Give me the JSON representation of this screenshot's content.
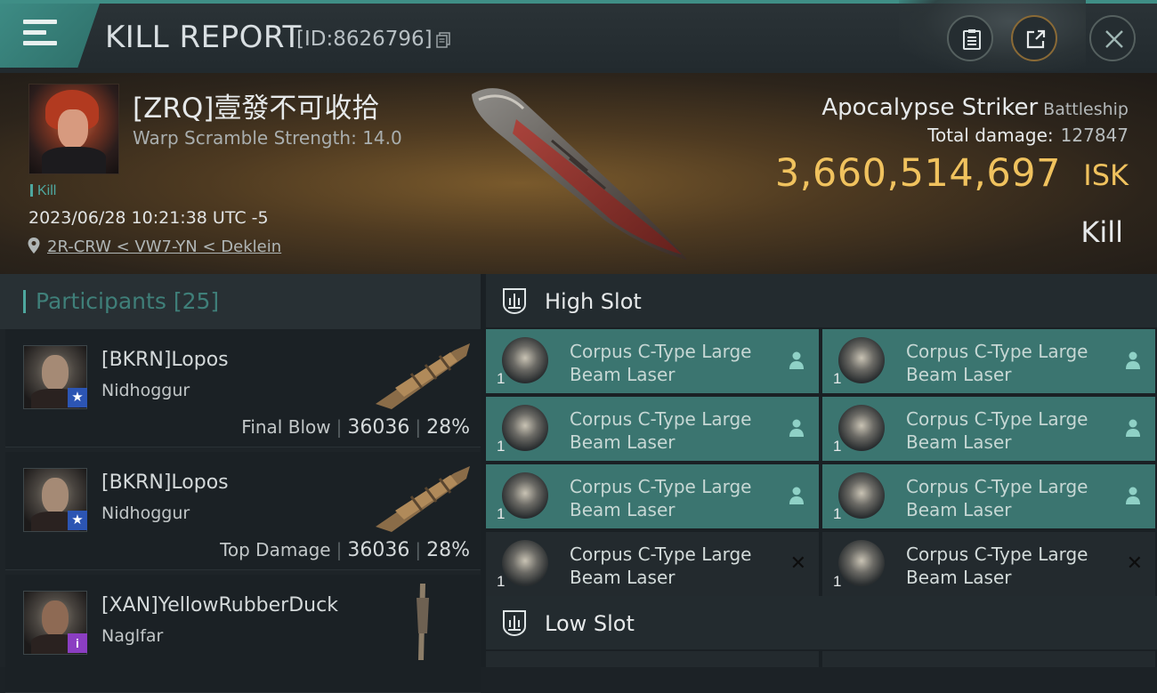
{
  "header": {
    "title": "KILL REPORT",
    "report_id": "[ID:8626796]"
  },
  "victim": {
    "name": "[ZRQ]壹發不可收拾",
    "warp_scramble": "Warp Scramble Strength: 14.0",
    "kill_tag": "Kill",
    "datetime": "2023/06/28 10:21:38 UTC -5",
    "location": "2R-CRW < VW7-YN < Deklein",
    "ship_name": "Apocalypse Striker",
    "ship_class": "Battleship",
    "total_damage_label": "Total damage:",
    "total_damage": "127847",
    "isk_value": "3,660,514,697",
    "isk_unit": "ISK",
    "status": "Kill"
  },
  "participants": {
    "title": "Participants",
    "count": "[25]",
    "items": [
      {
        "name": "[BKRN]Lopos",
        "ship": "Nidhoggur",
        "role": "Final Blow",
        "damage": "36036",
        "percent": "28%",
        "badge": "star"
      },
      {
        "name": "[BKRN]Lopos",
        "ship": "Nidhoggur",
        "role": "Top Damage",
        "damage": "36036",
        "percent": "28%",
        "badge": "star"
      },
      {
        "name": "[XAN]YellowRubberDuck",
        "ship": "Naglfar",
        "role": "",
        "damage": "",
        "percent": "",
        "badge": "i"
      }
    ]
  },
  "fitting": {
    "high_slot_title": "High Slot",
    "low_slot_title": "Low Slot",
    "high_modules": [
      {
        "line1": "Corpus C-Type Large",
        "line2": "Beam Laser",
        "qty": "1",
        "state": "fitted"
      },
      {
        "line1": "Corpus C-Type Large",
        "line2": "Beam Laser",
        "qty": "1",
        "state": "fitted"
      },
      {
        "line1": "Corpus C-Type Large",
        "line2": "Beam Laser",
        "qty": "1",
        "state": "fitted"
      },
      {
        "line1": "Corpus C-Type Large",
        "line2": "Beam Laser",
        "qty": "1",
        "state": "fitted"
      },
      {
        "line1": "Corpus C-Type Large",
        "line2": "Beam Laser",
        "qty": "1",
        "state": "fitted"
      },
      {
        "line1": "Corpus C-Type Large",
        "line2": "Beam Laser",
        "qty": "1",
        "state": "fitted"
      },
      {
        "line1": "Corpus C-Type Large",
        "line2": "Beam Laser",
        "qty": "1",
        "state": "destroyed"
      },
      {
        "line1": "Corpus C-Type Large",
        "line2": "Beam Laser",
        "qty": "1",
        "state": "destroyed"
      }
    ]
  },
  "colors": {
    "accent_teal": "#3f8e86",
    "fitted_module": "#3b7570",
    "isk_gold": "#f0c25e"
  },
  "icons": [
    "menu-icon",
    "copy-icon",
    "clipboard-icon",
    "share-icon",
    "close-icon",
    "location-pin-icon",
    "high-slot-icon",
    "low-slot-icon",
    "person-icon",
    "x-icon"
  ]
}
